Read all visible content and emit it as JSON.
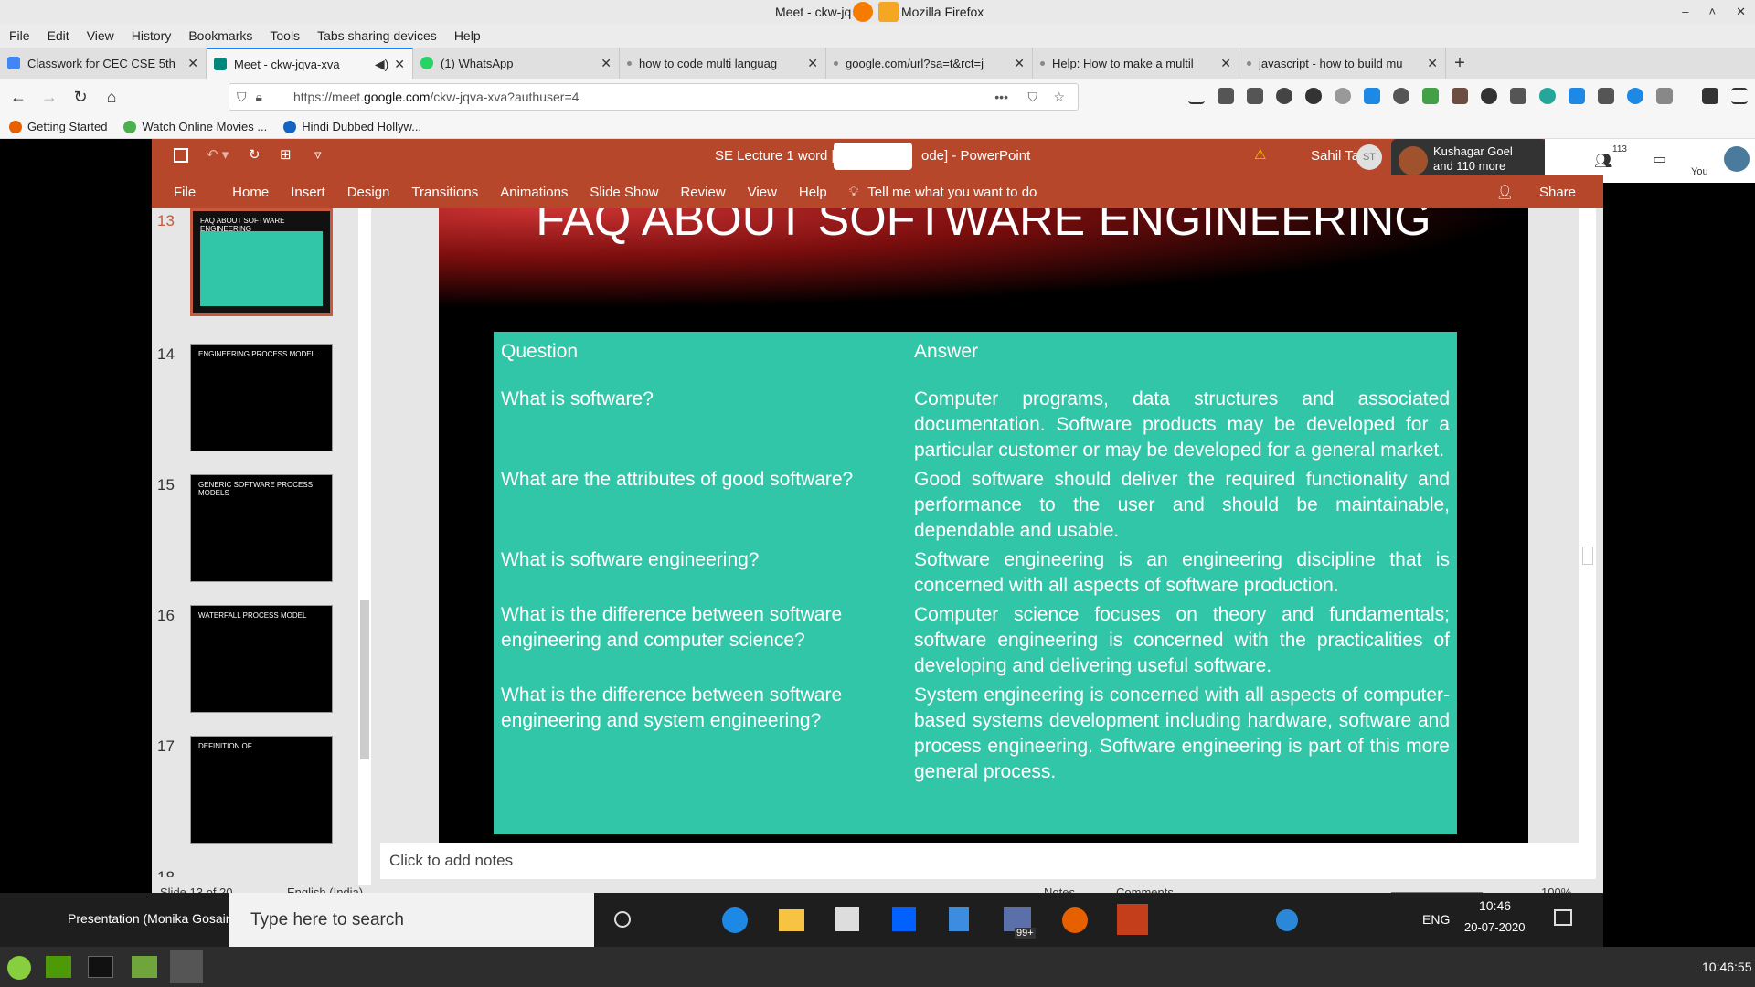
{
  "window": {
    "title_left": "Meet - ckw-jq",
    "title_right": "Mozilla Firefox"
  },
  "menubar": [
    "File",
    "Edit",
    "View",
    "History",
    "Bookmarks",
    "Tools",
    "Tabs sharing devices",
    "Help"
  ],
  "tabs": [
    {
      "label": "Classwork for CEC CSE 5th",
      "active": false,
      "color": "#4285f4"
    },
    {
      "label": "Meet - ckw-jqva-xva",
      "active": true,
      "color": "#00897b"
    },
    {
      "label": "(1) WhatsApp",
      "active": false,
      "color": "#25d366"
    },
    {
      "label": "how to code multi languag",
      "active": false,
      "color": "#888888"
    },
    {
      "label": "google.com/url?sa=t&rct=j",
      "active": false,
      "color": "#888888"
    },
    {
      "label": "Help: How to make a multil",
      "active": false,
      "color": "#888888"
    },
    {
      "label": "javascript - how to build mu",
      "active": false,
      "color": "#888888"
    }
  ],
  "url": {
    "prefix": "https://meet.",
    "domain": "google.com",
    "path": "/ckw-jqva-xva?authuser=4"
  },
  "bookmarks": [
    "Getting Started",
    "Watch Online Movies ...",
    "Hindi Dubbed Hollyw..."
  ],
  "ppt": {
    "doc_title": "SE Lecture 1 word [",
    "doc_title_end": "ode]  -  PowerPoint",
    "user": "Sahil Takhi",
    "user_initials": "ST",
    "participants": "Kushagar Goel",
    "participants_more": "and 110 more",
    "participant_count": "113",
    "you_label": "You",
    "ribbon": [
      "File",
      "Home",
      "Insert",
      "Design",
      "Transitions",
      "Animations",
      "Slide Show",
      "Review",
      "View",
      "Help"
    ],
    "tell_me": "Tell me what you want to do",
    "share": "Share",
    "thumbs": [
      {
        "num": "13",
        "label": "FAQ ABOUT SOFTWARE ENGINEERING"
      },
      {
        "num": "14",
        "label": "ENGINEERING PROCESS MODEL"
      },
      {
        "num": "15",
        "label": "GENERIC SOFTWARE PROCESS MODELS"
      },
      {
        "num": "16",
        "label": "WATERFALL PROCESS MODEL"
      },
      {
        "num": "17",
        "label": "DEFINITION OF"
      },
      {
        "num": "18",
        "label": ""
      }
    ],
    "slide_title": "FAQ ABOUT SOFTWARE ENGINEERING",
    "table": {
      "header": {
        "q": "Question",
        "a": "Answer"
      },
      "rows": [
        {
          "q": "What is software?",
          "a": "Computer programs, data structures and associated documentation. Software products may be developed for a particular customer or may be developed for a general market."
        },
        {
          "q": "What are the attributes of good software?",
          "a": "Good software should deliver the required functionality and performance to the user and should be maintainable, dependable and usable."
        },
        {
          "q": "What is software engineering?",
          "a": "Software engineering is an engineering discipline that is concerned with all aspects of software production."
        },
        {
          "q": "What is the difference between software engineering and computer science?",
          "a": "Computer science focuses on theory and fundamentals; software engineering is concerned with the practicalities of developing and delivering useful software."
        },
        {
          "q": "What is the difference between software engineering and system engineering?",
          "a": "System engineering is concerned with all aspects of computer-based systems development including hardware, software and process engineering. Software engineering is part of this more general process."
        }
      ]
    },
    "notes_placeholder": "Click to add notes",
    "status": {
      "slide": "Slide 13 of 20",
      "language": "English (India)",
      "notes": "Notes",
      "comments": "Comments",
      "zoom": "100%"
    }
  },
  "win_taskbar": {
    "presenter": "Presentation (Monika Gosain)",
    "search": "Type here to search",
    "lang": "ENG",
    "time": "10:46",
    "date": "20-07-2020",
    "badge": "99+"
  },
  "mint_clock": "10:46:55"
}
